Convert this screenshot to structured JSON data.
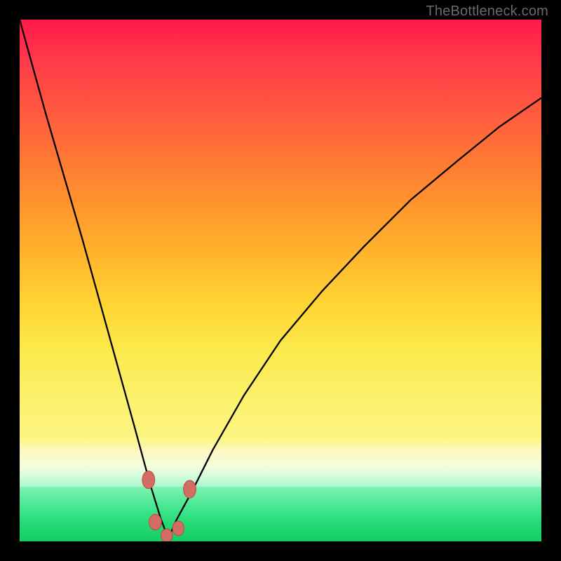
{
  "attribution": "TheBottleneck.com",
  "colors": {
    "curve": "#000000",
    "bead": "#d36d64",
    "bead_stroke": "#bb4a42",
    "bg_top": "#ff1a4a",
    "bg_bottom": "#14cf62"
  },
  "chart_data": {
    "type": "line",
    "title": "",
    "xlabel": "",
    "ylabel": "",
    "xlim": [
      0,
      1
    ],
    "ylim": [
      0,
      1
    ],
    "note": "Axes are implicit (no ticks/labels rendered). Values are normalized 0–1 for x (left→right) and y (bottom→top). The curve is a sharp V with minimum near x≈0.28, y≈0; left branch steep from top-left corner, right branch shallower reaching ~y≈0.85 at x=1.",
    "series": [
      {
        "name": "curve",
        "x": [
          0.0,
          0.05,
          0.12,
          0.17,
          0.22,
          0.25,
          0.27,
          0.285,
          0.3,
          0.33,
          0.37,
          0.43,
          0.5,
          0.58,
          0.66,
          0.75,
          0.84,
          0.92,
          1.0
        ],
        "y": [
          1.0,
          0.82,
          0.58,
          0.4,
          0.22,
          0.11,
          0.045,
          0.005,
          0.04,
          0.095,
          0.175,
          0.28,
          0.385,
          0.48,
          0.565,
          0.655,
          0.73,
          0.795,
          0.85
        ]
      }
    ],
    "markers": [
      {
        "x": 0.247,
        "y": 0.118,
        "rx": 0.012,
        "ry": 0.017
      },
      {
        "x": 0.26,
        "y": 0.037,
        "rx": 0.012,
        "ry": 0.015
      },
      {
        "x": 0.282,
        "y": 0.011,
        "rx": 0.011,
        "ry": 0.013
      },
      {
        "x": 0.304,
        "y": 0.025,
        "rx": 0.011,
        "ry": 0.014
      },
      {
        "x": 0.326,
        "y": 0.1,
        "rx": 0.012,
        "ry": 0.017
      }
    ]
  }
}
